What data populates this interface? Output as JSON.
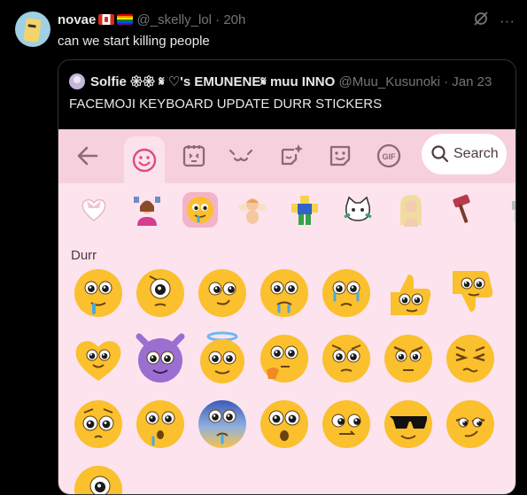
{
  "tweet": {
    "display_name": "novae",
    "handle": "@_skelly_lol",
    "separator": "·",
    "time": "20h",
    "text": "can we start killing people",
    "more_label": "···"
  },
  "quote": {
    "display_name": "Solfie 𑁍𑁍 𝄋 ♡'s EMUNENE𝄋 muu INNO",
    "handle": "@Muu_Kusunoki",
    "separator": "·",
    "date": "Jan 23",
    "text": "FACEMOJI KEYBOARD UPDATE DURR STICKERS"
  },
  "keyboard": {
    "search_label": "Search",
    "gif_label": "GIF",
    "section_title": "Durr",
    "colors": {
      "tab_bar": "#f6d0dd",
      "panel": "#fde3ee",
      "icon": "#8c6a78",
      "emoji_yellow": "#fbc02d",
      "emoji_purple": "#9a6fd1"
    },
    "tabs": [
      "back-arrow-icon",
      "smiley-icon",
      "emoticon-icon",
      "kaomoji-icon",
      "sticker-sparkle-icon",
      "sticker-icon",
      "gif-icon"
    ],
    "stickers": [
      "heart-bow-sticker",
      "woman-shrug-sticker",
      "drool-face-sticker",
      "cherub-sticker",
      "blocky-avatar-sticker",
      "cat-character-sticker",
      "blonde-doll-sticker",
      "hammer-sticker",
      "partial-sticker"
    ],
    "emojis": [
      {
        "name": "durr-drool-emoji",
        "type": "drool"
      },
      {
        "name": "durr-single-eye-emoji",
        "type": "oneeye"
      },
      {
        "name": "durr-smirk-emoji",
        "type": "smirk"
      },
      {
        "name": "durr-sweat-emoji",
        "type": "sweat"
      },
      {
        "name": "durr-cry-emoji",
        "type": "cry"
      },
      {
        "name": "durr-thumbs-up-emoji",
        "type": "thumbup"
      },
      {
        "name": "durr-thumbs-down-emoji",
        "type": "thumbdown"
      },
      {
        "name": "durr-heart-emoji",
        "type": "heart"
      },
      {
        "name": "durr-devil-emoji",
        "type": "devil"
      },
      {
        "name": "durr-halo-emoji",
        "type": "halo"
      },
      {
        "name": "durr-thinking-emoji",
        "type": "think"
      },
      {
        "name": "durr-worried-emoji",
        "type": "worried"
      },
      {
        "name": "durr-angry-emoji",
        "type": "angry"
      },
      {
        "name": "durr-squint-emoji",
        "type": "squint"
      },
      {
        "name": "durr-pleading-emoji",
        "type": "plead"
      },
      {
        "name": "durr-gasp-emoji",
        "type": "gasp"
      },
      {
        "name": "durr-cold-emoji",
        "type": "cold"
      },
      {
        "name": "durr-wow-emoji",
        "type": "wow"
      },
      {
        "name": "durr-side-eye-emoji",
        "type": "side"
      },
      {
        "name": "durr-sunglasses-emoji",
        "type": "cool"
      },
      {
        "name": "durr-smug-emoji",
        "type": "smug"
      },
      {
        "name": "durr-cyclops-emoji",
        "type": "cyclops"
      }
    ]
  }
}
